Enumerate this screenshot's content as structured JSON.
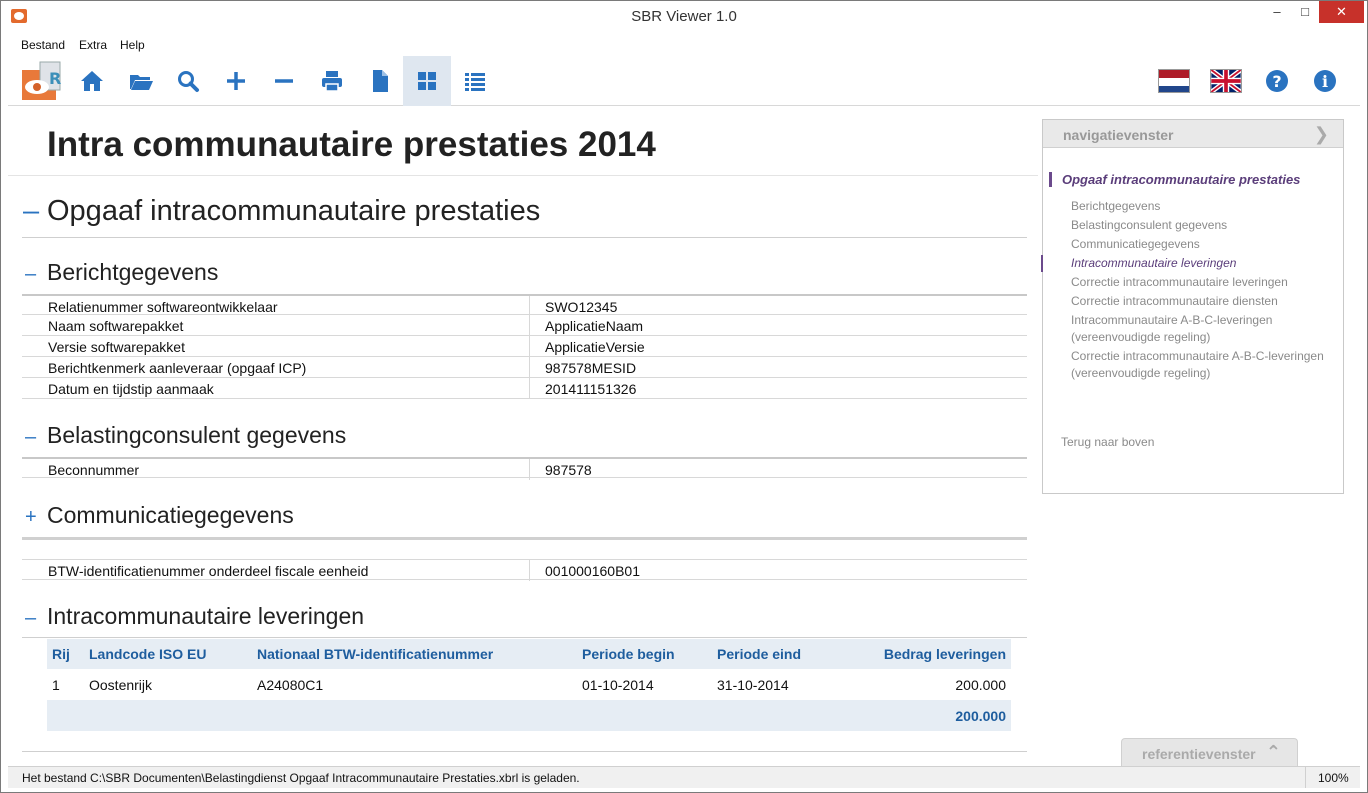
{
  "window": {
    "title": "SBR Viewer 1.0"
  },
  "menu": [
    "Bestand",
    "Extra",
    "Help"
  ],
  "toolbar": {
    "icons": [
      "home-icon",
      "folder-open-icon",
      "search-icon",
      "plus-icon",
      "minus-icon",
      "print-icon",
      "document-icon",
      "grid-view-icon",
      "list-view-icon",
      "flag-nl-icon",
      "flag-uk-icon",
      "help-icon",
      "info-icon"
    ],
    "active": "grid-view-icon",
    "accent": "#2a73c0"
  },
  "page": {
    "title": "Intra communautaire prestaties 2014",
    "section": {
      "toggle": "–",
      "title": "Opgaaf intracommunautaire prestaties"
    }
  },
  "berichtgegevens": {
    "toggle": "–",
    "title": "Berichtgegevens",
    "rows": [
      {
        "k": "Relatienummer softwareontwikkelaar",
        "v": "SWO12345"
      },
      {
        "k": "Naam softwarepakket",
        "v": "ApplicatieNaam"
      },
      {
        "k": "Versie softwarepakket",
        "v": "ApplicatieVersie"
      },
      {
        "k": "Berichtkenmerk aanleveraar (opgaaf ICP)",
        "v": "987578MESID"
      },
      {
        "k": "Datum en tijdstip aanmaak",
        "v": "201411151326"
      }
    ]
  },
  "belastingconsulent": {
    "toggle": "–",
    "title": "Belastingconsulent gegevens",
    "rows": [
      {
        "k": "Beconnummer",
        "v": "987578"
      }
    ]
  },
  "communicatie": {
    "toggle": "+",
    "title": "Communicatiegegevens",
    "rows": [
      {
        "k": "BTW-identificatienummer onderdeel fiscale eenheid",
        "v": "001000160B01"
      }
    ]
  },
  "leveringen": {
    "toggle": "–",
    "title": "Intracommunautaire leveringen",
    "columns": [
      "Rij",
      "Landcode ISO EU",
      "Nationaal BTW-identificatienummer",
      "Periode begin",
      "Periode eind",
      "Bedrag leveringen"
    ],
    "rows": [
      {
        "rij": "1",
        "land": "Oostenrijk",
        "btw": "A24080C1",
        "begin": "01-10-2014",
        "eind": "31-10-2014",
        "bedrag": "200.000"
      }
    ],
    "total": "200.000"
  },
  "nav": {
    "header": "navigatievenster",
    "current": "Opgaaf intracommunautaire prestaties",
    "items": [
      "Berichtgegevens",
      "Belastingconsulent gegevens",
      "Communicatiegegevens",
      "Intracommunautaire leveringen",
      "Correctie intracommunautaire leveringen",
      "Correctie intracommunautaire diensten",
      "Intracommunautaire A-B-C-leveringen",
      "(vereenvoudigde regeling)",
      "Correctie intracommunautaire A-B-C-leveringen",
      "(vereenvoudigde regeling)"
    ],
    "selected_index": 3,
    "back_to_top": "Terug naar boven"
  },
  "reference": {
    "label": "referentievenster"
  },
  "status": {
    "message": "Het bestand C:\\SBR Documenten\\Belastingdienst Opgaaf Intracommunautaire Prestaties.xbrl is geladen.",
    "zoom": "100%"
  }
}
